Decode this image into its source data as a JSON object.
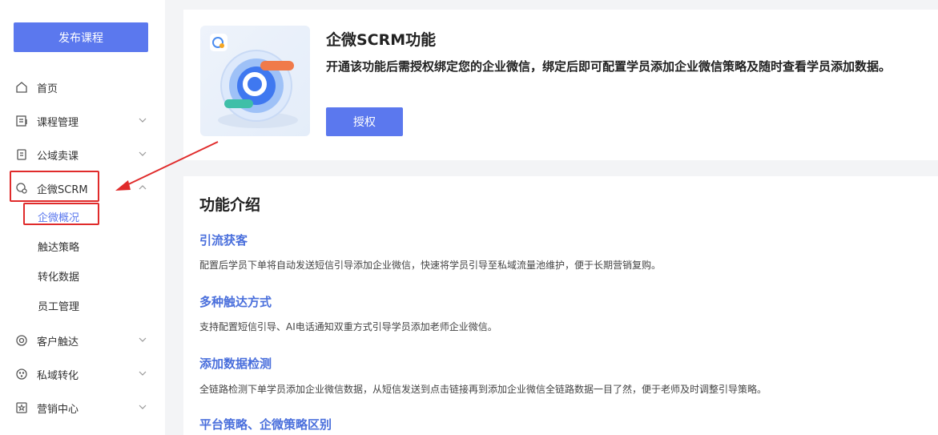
{
  "sidebar": {
    "publish_label": "发布课程",
    "items": [
      {
        "label": "首页",
        "icon": "home-icon"
      },
      {
        "label": "课程管理",
        "icon": "course-icon"
      },
      {
        "label": "公域卖课",
        "icon": "public-sale-icon"
      },
      {
        "label": "企微SCRM",
        "icon": "wecom-scrm-icon"
      },
      {
        "label": "客户触达",
        "icon": "customer-reach-icon"
      },
      {
        "label": "私域转化",
        "icon": "private-conversion-icon"
      },
      {
        "label": "营销中心",
        "icon": "marketing-icon"
      }
    ],
    "sub_items": [
      {
        "label": "企微概况"
      },
      {
        "label": "触达策略"
      },
      {
        "label": "转化数据"
      },
      {
        "label": "员工管理"
      }
    ]
  },
  "feature": {
    "title": "企微SCRM功能",
    "description": "开通该功能后需授权绑定您的企业微信，绑定后即可配置学员添加企业微信策略及随时查看学员添加数据。",
    "authorize_label": "授权"
  },
  "intro": {
    "title": "功能介绍",
    "sections": [
      {
        "title": "引流获客",
        "desc": "配置后学员下单将自动发送短信引导添加企业微信，快速将学员引导至私域流量池维护，便于长期营销复购。"
      },
      {
        "title": "多种触达方式",
        "desc": "支持配置短信引导、AI电话通知双重方式引导学员添加老师企业微信。"
      },
      {
        "title": "添加数据检测",
        "desc": "全链路检测下单学员添加企业微信数据，从短信发送到点击链接再到添加企业微信全链路数据一目了然，便于老师及时调整引导策略。"
      },
      {
        "title": "平台策略、企微策略区别",
        "desc": ""
      }
    ]
  },
  "colors": {
    "accent": "#5b78ee",
    "link": "#4a6fdc",
    "highlight": "#e02b2b"
  }
}
